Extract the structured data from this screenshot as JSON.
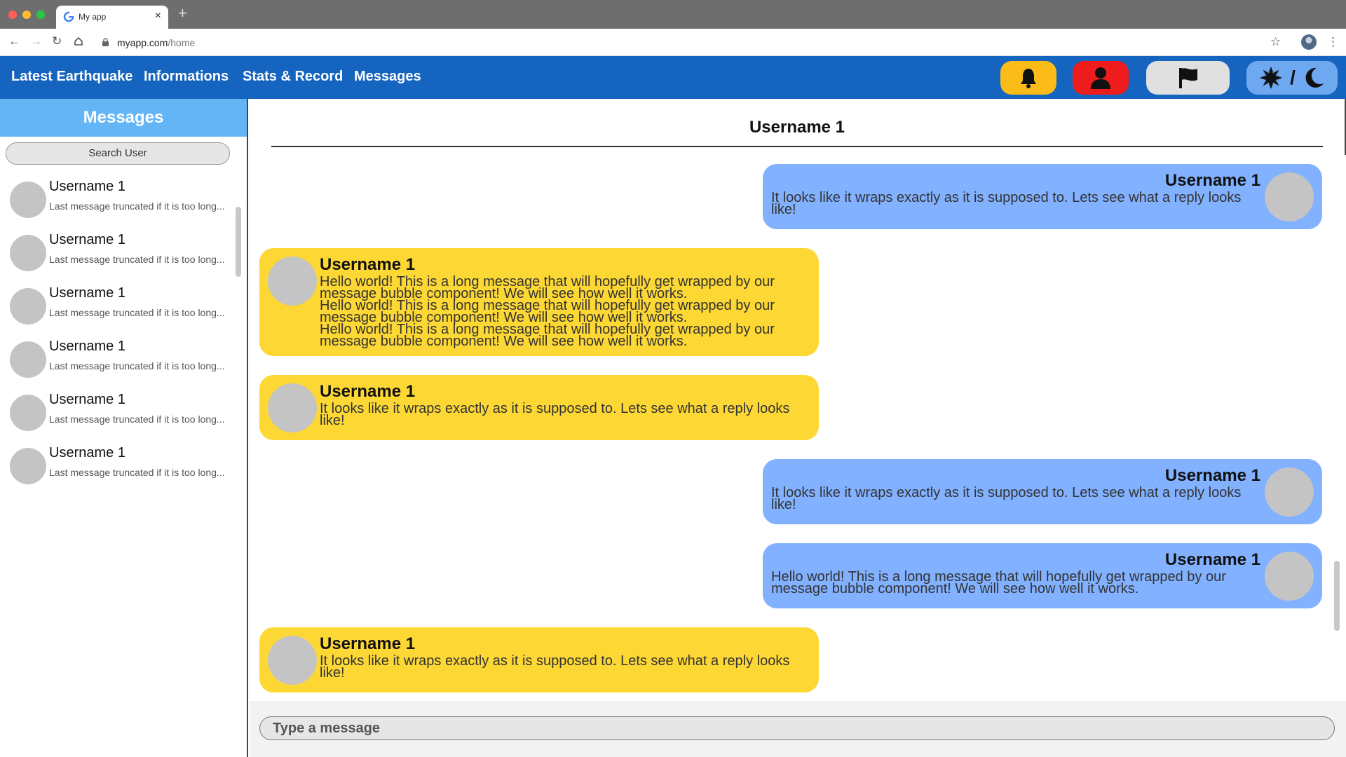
{
  "browser": {
    "tab_title": "My app",
    "new_tab_icon": "plus-icon",
    "url_domain": "myapp.com",
    "url_path": "/home"
  },
  "nav": {
    "links": [
      "Latest Earthquake",
      "Informations",
      "Stats & Record",
      "Messages"
    ],
    "buttons": [
      {
        "icon": "bell-icon",
        "color": "#fbbc1a"
      },
      {
        "icon": "user-icon",
        "color": "#ee1c1c"
      },
      {
        "icon": "flag-icon",
        "color": "#e0e0e0"
      },
      {
        "icon": "sun-moon-icon",
        "color": "#6ea8f0"
      }
    ],
    "theme_separator": "/"
  },
  "sidebar": {
    "title": "Messages",
    "search_label": "Search User",
    "conversations": [
      {
        "name": "Username 1",
        "last": "Last message truncated if it is too long..."
      },
      {
        "name": "Username 1",
        "last": "Last message truncated if it is too long..."
      },
      {
        "name": "Username 1",
        "last": "Last message truncated if it is too long..."
      },
      {
        "name": "Username 1",
        "last": "Last message truncated if it is too long..."
      },
      {
        "name": "Username 1",
        "last": "Last message truncated if it is too long..."
      },
      {
        "name": "Username 1",
        "last": "Last message truncated if it is too long..."
      }
    ]
  },
  "chat": {
    "title": "Username 1",
    "messages": [
      {
        "side": "right",
        "name": "Username 1",
        "lines": [
          "It looks like it wraps exactly as it is supposed to. Lets see what a reply looks",
          "like!"
        ]
      },
      {
        "side": "left",
        "name": "Username 1",
        "lines": [
          "Hello world! This is a long message that will hopefully get wrapped by our",
          "message bubble component! We will see how well it works.",
          "Hello world! This is a long message that will hopefully get wrapped by our",
          "message bubble component! We will see how well it works.",
          "Hello world! This is a long message that will hopefully get wrapped by our",
          "message bubble component! We will see how well it works."
        ]
      },
      {
        "side": "left",
        "name": "Username 1",
        "lines": [
          "It looks like it wraps exactly as it is supposed to. Lets see what a reply looks",
          "like!"
        ]
      },
      {
        "side": "right",
        "name": "Username 1",
        "lines": [
          "It looks like it wraps exactly as it is supposed to. Lets see what a reply looks",
          "like!"
        ]
      },
      {
        "side": "right",
        "name": "Username 1",
        "lines": [
          "Hello world! This is a long message that will hopefully get wrapped by our",
          "message bubble component! We will see how well it works."
        ]
      },
      {
        "side": "left",
        "name": "Username 1",
        "lines": [
          "It looks like it wraps exactly as it is supposed to. Lets see what a reply looks",
          "like!"
        ]
      }
    ],
    "composer_placeholder": "Type a message"
  },
  "colors": {
    "nav_bg": "#1565c0",
    "sidebar_header": "#64b5f6",
    "bubble_self": "#82b1ff",
    "bubble_other": "#fdd835"
  }
}
